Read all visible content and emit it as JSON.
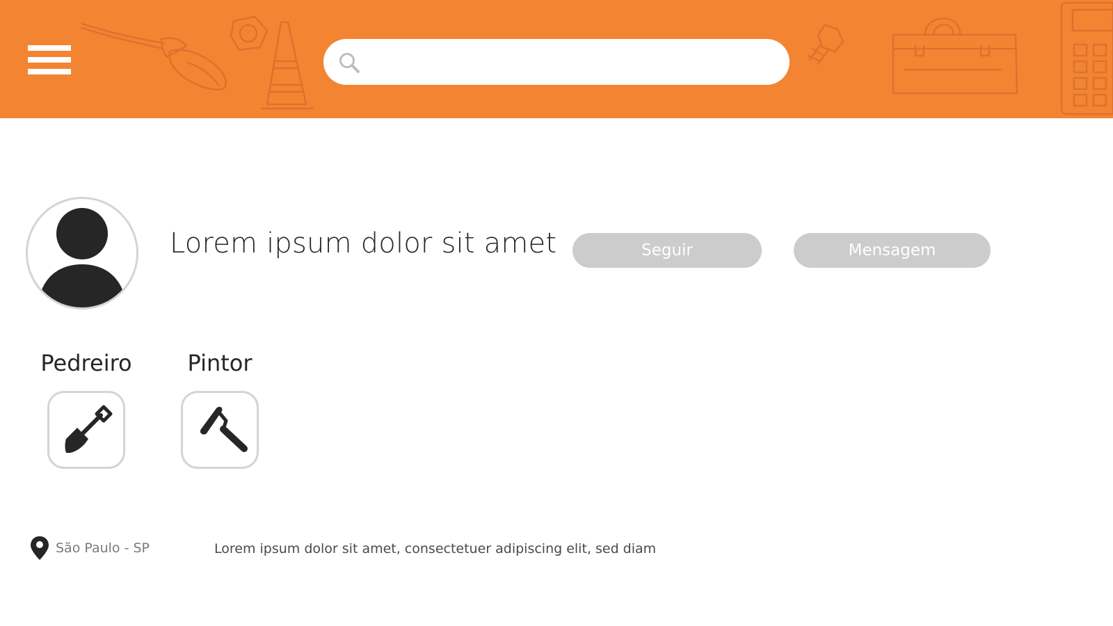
{
  "theme": {
    "accent": "#f38432",
    "button_gray": "#cccccc",
    "border_gray": "#d4d4d4",
    "icon_dark": "#262626"
  },
  "header": {
    "menu_icon": "hamburger-menu-icon",
    "search": {
      "icon": "search-icon",
      "placeholder": "",
      "value": ""
    },
    "background_doodles": [
      "paint-brush",
      "nut",
      "traffic-cone",
      "bolt",
      "toolbox",
      "calculator"
    ]
  },
  "profile": {
    "avatar_icon": "user-avatar-icon",
    "name": "Lorem ipsum dolor sit amet",
    "follow_label": "Seguir",
    "message_label": "Mensagem"
  },
  "skills": [
    {
      "label": "Pedreiro",
      "icon": "shovel-icon"
    },
    {
      "label": "Pintor",
      "icon": "paint-roller-icon"
    }
  ],
  "location": {
    "icon": "location-pin-icon",
    "text": "São Paulo - SP"
  },
  "bio": "Lorem ipsum dolor sit amet, consectetuer adipiscing elit, sed diam"
}
